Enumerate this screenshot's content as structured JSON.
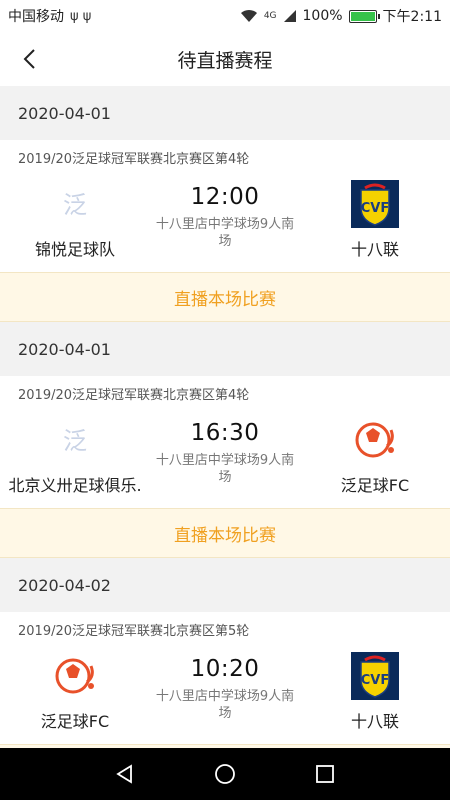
{
  "status_bar": {
    "carrier": "中国移动",
    "extra_icons": "ψ ψ",
    "network": "4G",
    "battery": "100%",
    "battery_level": 1.0,
    "time": "下午2:11"
  },
  "header": {
    "title": "待直播赛程"
  },
  "matches": [
    {
      "date": "2020-04-01",
      "league": "2019/20泛足球冠军联赛北京赛区第4轮",
      "home": {
        "name": "锦悦足球队",
        "logo": "fan-placeholder"
      },
      "time": "12:00",
      "venue": "十八里店中学球场9人南场",
      "away": {
        "name": "十八联",
        "logo": "villarreal-crest"
      },
      "button": "直播本场比赛"
    },
    {
      "date": "2020-04-01",
      "league": "2019/20泛足球冠军联赛北京赛区第4轮",
      "home": {
        "name": "北京义卅足球俱乐.",
        "logo": "fan-placeholder"
      },
      "time": "16:30",
      "venue": "十八里店中学球场9人南场",
      "away": {
        "name": "泛足球FC",
        "logo": "fanzuqiu-ball"
      },
      "button": "直播本场比赛"
    },
    {
      "date": "2020-04-02",
      "league": "2019/20泛足球冠军联赛北京赛区第5轮",
      "home": {
        "name": "泛足球FC",
        "logo": "fanzuqiu-ball"
      },
      "time": "10:20",
      "venue": "十八里店中学球场9人南场",
      "away": {
        "name": "十八联",
        "logo": "villarreal-crest"
      },
      "button": "直播本场比赛"
    }
  ],
  "nav": {
    "back": "back-triangle-icon",
    "home": "home-circle-icon",
    "recents": "recents-square-icon"
  },
  "colors": {
    "accent": "#f0a020",
    "live_bg": "#fff8e6",
    "page_bg": "#f2f2f2"
  }
}
